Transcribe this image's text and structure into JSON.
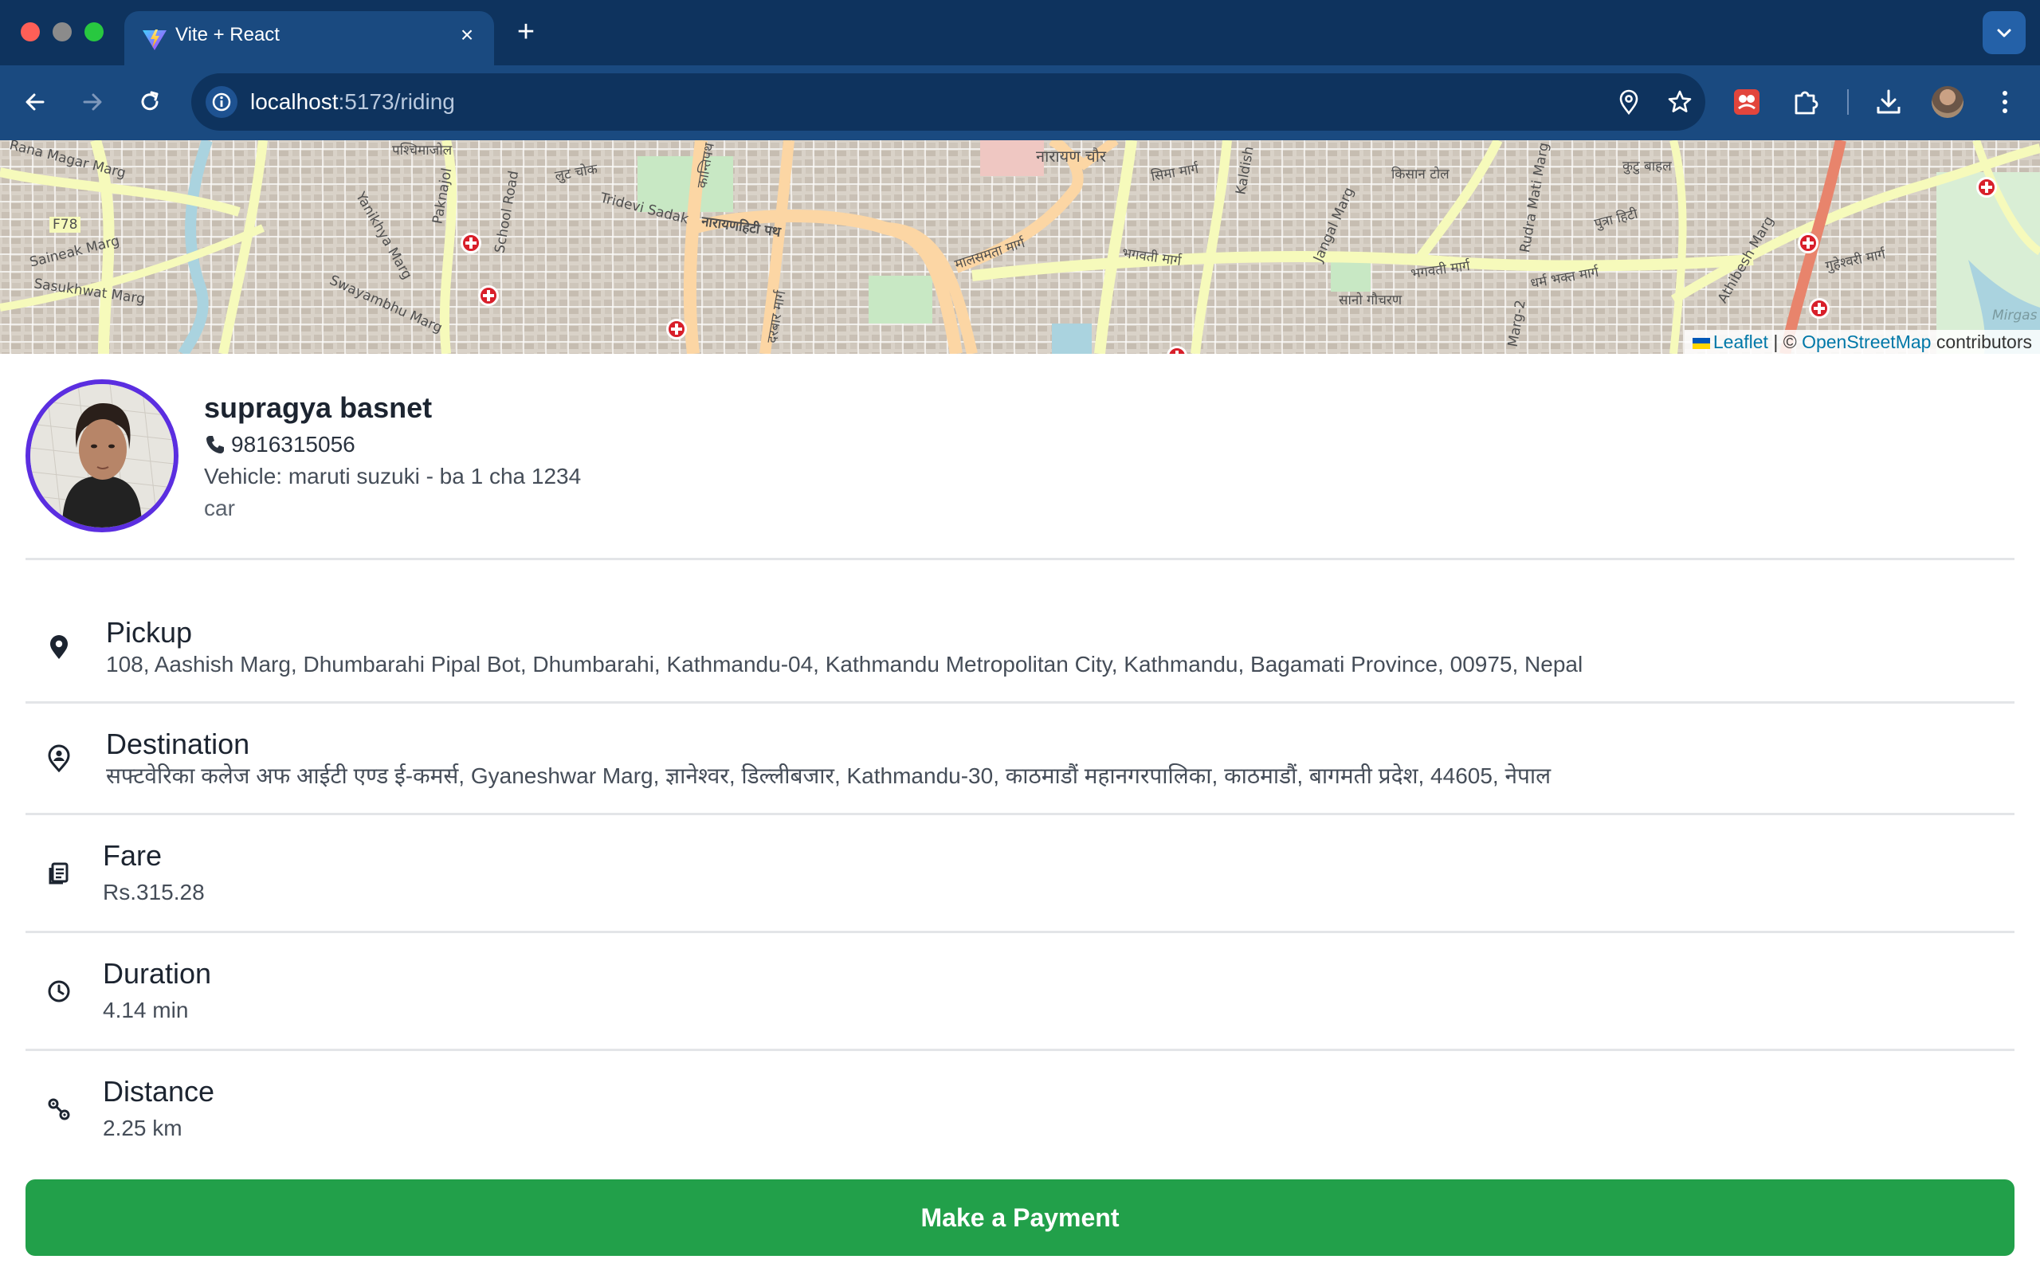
{
  "browser": {
    "tab": {
      "title": "Vite + React",
      "favicon": "vite-logo-icon"
    },
    "address_bar": {
      "host": "localhost",
      "path": ":5173/riding"
    },
    "icons": [
      "back-arrow-icon",
      "forward-arrow-icon",
      "reload-icon",
      "site-info-icon",
      "location-pin-icon",
      "bookmark-star-icon",
      "extension-icon",
      "puzzle-icon",
      "download-icon",
      "kebab-menu-icon"
    ]
  },
  "map": {
    "labels": [
      "Rana Magar Marg",
      "F78",
      "Saineak Marg",
      "Sasukhwat Marg",
      "पश्चिमाजोल",
      "Paknajol",
      "लुट चोक",
      "Tridevi Sadak",
      "नारायणहिटी पथ",
      "School Road",
      "Yanikhya Marg",
      "Swayambhu Marg",
      "नारायण चौर",
      "सिमा मार्ग",
      "भगवती मार्ग",
      "किसान टोल",
      "कुटु बाहल",
      "सानो गौचरण",
      "पुत्रा हिटी",
      "Jangal Marg",
      "Rudra Mati Marg",
      "दरबार मार्ग",
      "Mirgas",
      "Kaldish",
      "Marg-2",
      "भगवती मार्ग",
      "धर्म भक्त मार्ग",
      "गुहेश्वरी मार्ग",
      "Athibesh Marg",
      "कान्तिपथ",
      "मालसमता मार्ग"
    ],
    "attribution": {
      "leaflet": "Leaflet",
      "sep": "|",
      "copy": "©",
      "osm": "OpenStreetMap",
      "contrib": "contributors"
    }
  },
  "driver": {
    "name": "supragya basnet",
    "phone": "9816315056",
    "vehicle": "Vehicle: maruti suzuki - ba 1 cha 1234",
    "type": "car"
  },
  "ride": {
    "pickup": {
      "label": "Pickup",
      "value": "108, Aashish Marg, Dhumbarahi Pipal Bot, Dhumbarahi, Kathmandu-04, Kathmandu Metropolitan City, Kathmandu, Bagamati Province, 00975, Nepal",
      "icon": "location-pin-icon"
    },
    "destination": {
      "label": "Destination",
      "value": "सफ्टवेरिका कलेज अफ आईटी एण्ड ई-कमर्स, Gyaneshwar Marg, ज्ञानेश्वर, डिल्लीबजार, Kathmandu-30, काठमाडौं महानगरपालिका, काठमाडौं, बागमती प्रदेश, 44605, नेपाल",
      "icon": "person-pin-icon"
    },
    "fare": {
      "label": "Fare",
      "value": "Rs.315.28",
      "icon": "receipt-icon"
    },
    "duration": {
      "label": "Duration",
      "value": "4.14 min",
      "icon": "clock-icon"
    },
    "distance": {
      "label": "Distance",
      "value": "2.25 km",
      "icon": "route-icon"
    }
  },
  "actions": {
    "pay_label": "Make a Payment"
  },
  "colors": {
    "accent_green": "#22a04a",
    "avatar_ring": "#5b2ee0",
    "chrome_dark": "#0e335e",
    "chrome": "#1a4a80"
  }
}
